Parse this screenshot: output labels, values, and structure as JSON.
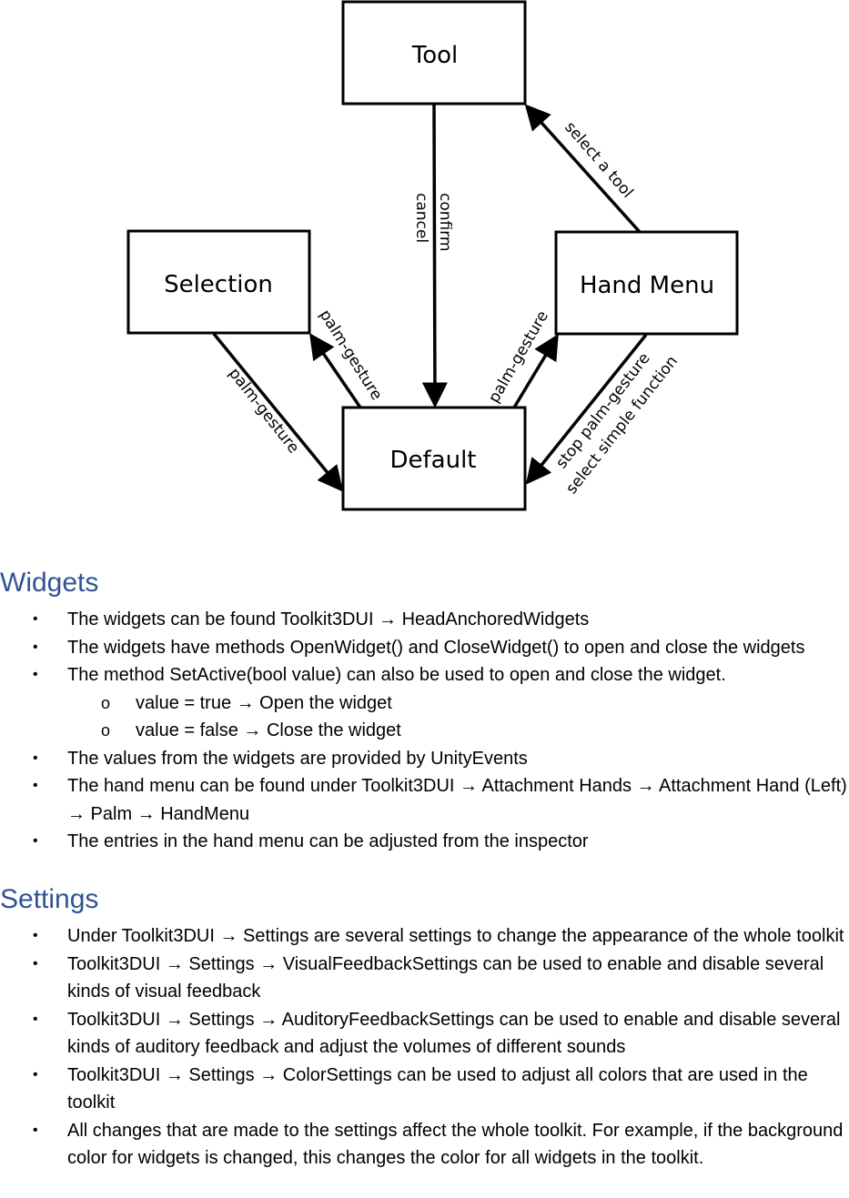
{
  "diagram": {
    "nodes": {
      "tool": "Tool",
      "selection": "Selection",
      "hand_menu": "Hand Menu",
      "default": "Default"
    },
    "edges": {
      "confirm": "confirm",
      "cancel": "cancel",
      "select_tool": "select a tool",
      "sel_to_default": "palm-gesture",
      "default_to_sel": "palm-gesture",
      "default_to_hand": "palm-gesture",
      "stop_palm": "stop palm-gesture",
      "select_simple": "select simple function"
    }
  },
  "widgets": {
    "heading": "Widgets",
    "items": [
      {
        "text": "The widgets can be found Toolkit3DUI → HeadAnchoredWidgets"
      },
      {
        "text": "The widgets have methods OpenWidget() and CloseWidget() to open and close the widgets"
      },
      {
        "text": "The method SetActive(bool value) can also be used to open and close the widget."
      },
      {
        "text": "value = true → Open the widget",
        "sub": true
      },
      {
        "text": "value = false → Close the widget",
        "sub": true
      },
      {
        "text": "The values from the widgets are provided by UnityEvents"
      },
      {
        "text": "The hand menu can be found under Toolkit3DUI → Attachment Hands → Attachment Hand (Left) → Palm → HandMenu"
      },
      {
        "text": "The entries in the hand menu can be adjusted from the inspector"
      }
    ]
  },
  "settings": {
    "heading": "Settings",
    "items": [
      {
        "text": "Under Toolkit3DUI → Settings are several settings to change the appearance of the whole toolkit"
      },
      {
        "text": "Toolkit3DUI → Settings → VisualFeedbackSettings can be used to enable and disable several kinds of visual feedback"
      },
      {
        "text": "Toolkit3DUI → Settings → AuditoryFeedbackSettings can be used to enable and disable several kinds of auditory feedback and adjust the volumes of different sounds"
      },
      {
        "text": "Toolkit3DUI → Settings → ColorSettings can be used to adjust all colors that are used in the toolkit"
      },
      {
        "text": "All changes that are made to the settings affect the whole toolkit. For example, if the background color for widgets is changed, this changes the color for all widgets in the toolkit."
      }
    ],
    "bullet": "•",
    "sub_bullet": "o"
  },
  "colors": {
    "heading": "#2f5496"
  }
}
